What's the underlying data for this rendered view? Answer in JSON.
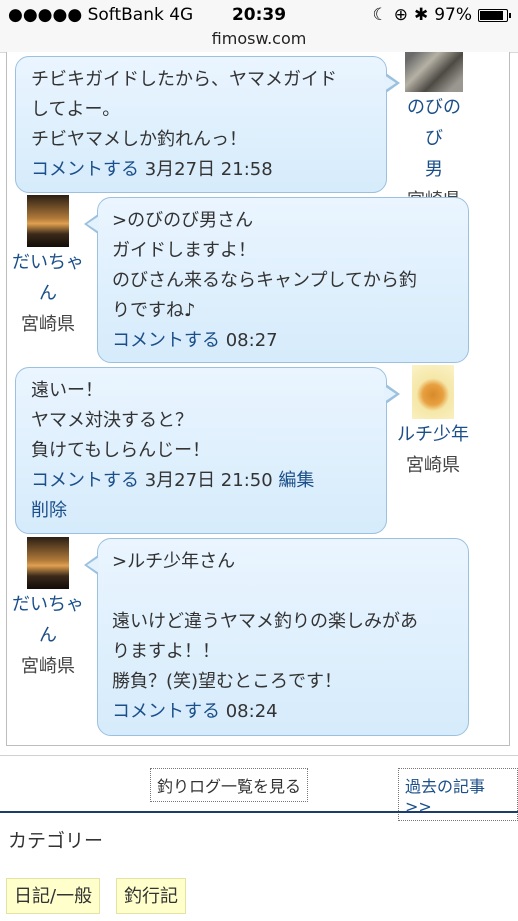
{
  "status_bar": {
    "carrier": "●●●●● SoftBank  4G",
    "time": "20:39",
    "battery_pct": "97%",
    "battery_level": 0.97
  },
  "browser": {
    "url": "fimosw.com"
  },
  "comments": [
    {
      "lines": [
        "チビキガイドしたから、ヤマメガイド",
        "してよー。",
        "チビヤマメしか釣れんっ！"
      ],
      "action": "コメントする",
      "date": "3月27日 21:58",
      "user": {
        "name_lines": [
          "のびのび",
          "男"
        ],
        "pref": "宮崎県",
        "avatar_icon": "fish-photo-avatar"
      }
    },
    {
      "lines": [
        ">のびのび男さん",
        "ガイドしますよ！",
        "のびさん来るならキャンプしてから釣",
        "りですね♪"
      ],
      "action": "コメントする",
      "date": "08:27",
      "user": {
        "name_lines": [
          "だいちゃ",
          "ん"
        ],
        "pref": "宮崎県",
        "avatar_icon": "sunset-photo-avatar"
      }
    },
    {
      "lines": [
        "遠いー！",
        "ヤマメ対決すると？",
        "負けてもしらんじー！"
      ],
      "action": "コメントする",
      "date": "3月27日 21:50",
      "edit": "編集",
      "delete": "削除",
      "user": {
        "name_lines": [
          "ルチ少年"
        ],
        "pref": "宮崎県",
        "avatar_icon": "puppy-avatar"
      }
    },
    {
      "lines": [
        ">ルチ少年さん",
        "",
        "遠いけど違うヤマメ釣りの楽しみがあ",
        "りますよ！！",
        "勝負？(笑)望むところです！"
      ],
      "action": "コメントする",
      "date": "08:24",
      "user": {
        "name_lines": [
          "だいちゃ",
          "ん"
        ],
        "pref": "宮崎県",
        "avatar_icon": "sunset-photo-avatar"
      }
    }
  ],
  "nav": {
    "log_list": "釣りログ一覧を見る",
    "past": "過去の記事 >>"
  },
  "category": {
    "title": "カテゴリー",
    "tags": [
      "日記/一般",
      "釣行記"
    ]
  }
}
